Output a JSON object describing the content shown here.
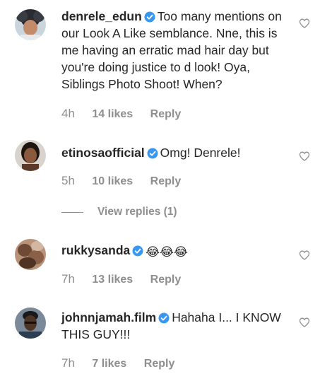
{
  "colors": {
    "text": "#262626",
    "secondary": "#8e8e8e",
    "verified": "#3897f0"
  },
  "comments": [
    {
      "username": "denrele_edun",
      "verified": true,
      "text": "Too many mentions on our Look A Like semblance. Nne, this is me having an erratic mad hair day but you're doing justice to d look! Oya, Siblings Photo Shoot! When?",
      "time": "4h",
      "likes": "14 likes",
      "reply": "Reply",
      "icons": {
        "like": "heart-outline-icon",
        "verified": "verified-badge-icon"
      }
    },
    {
      "username": "etinosaofficial",
      "verified": true,
      "text": "Omg! Denrele!",
      "time": "5h",
      "likes": "10 likes",
      "reply": "Reply",
      "icons": {
        "like": "heart-outline-icon",
        "verified": "verified-badge-icon"
      }
    },
    {
      "username": "rukkysanda",
      "verified": true,
      "text": "😂😂😂",
      "time": "7h",
      "likes": "13 likes",
      "reply": "Reply",
      "icons": {
        "like": "heart-outline-icon",
        "verified": "verified-badge-icon"
      }
    },
    {
      "username": "johnnjamah.film",
      "verified": true,
      "text": "Hahaha I... I KNOW THIS GUY!!!",
      "time": "7h",
      "likes": "7 likes",
      "reply": "Reply",
      "icons": {
        "like": "heart-outline-icon",
        "verified": "verified-badge-icon"
      }
    }
  ],
  "view_replies": {
    "label": "View replies (1)"
  }
}
